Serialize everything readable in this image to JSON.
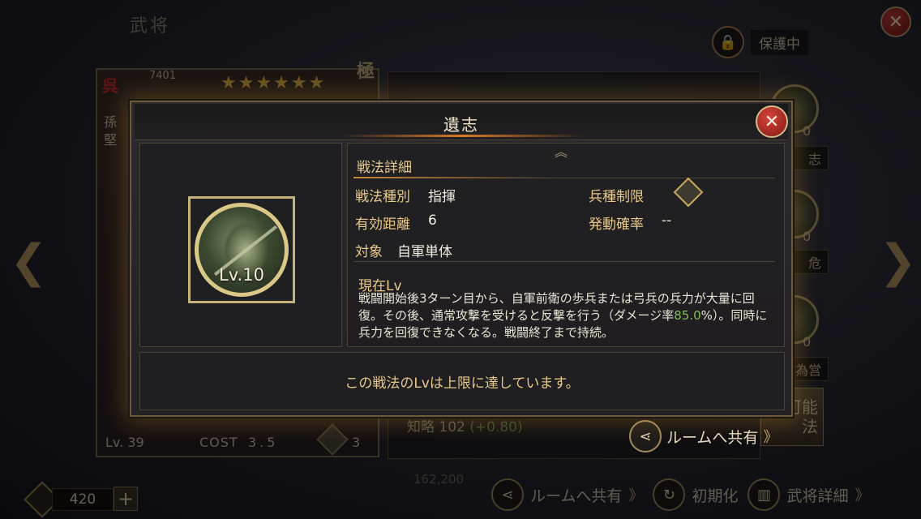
{
  "background": {
    "screen_title": "武将",
    "lock_label": "保護中",
    "card": {
      "kingdom": "呉",
      "number": "7401",
      "stars": "★★★★★★",
      "name": "孫堅",
      "grade": "極",
      "level": "Lv. 39",
      "cost_label": "COST",
      "cost_value": "3.5",
      "troop_number": "3"
    },
    "side_tags": [
      "志",
      "危",
      "為営"
    ],
    "side_nums": [
      "0",
      "0",
      "0"
    ],
    "intel_label": "知略",
    "intel_value": "102",
    "intel_bonus": "(+0.80)",
    "faint_stat": "162,200",
    "possible_button": [
      "可能",
      "法"
    ],
    "share_inner": "ルームへ共有",
    "gem_count": "420",
    "plus": "+",
    "bottom_actions": {
      "share": "ルームへ共有",
      "reset": "初期化",
      "detail": "武将詳細"
    },
    "chevrons": "》"
  },
  "modal": {
    "title": "遺志",
    "skill_level": "Lv.10",
    "section_title": "戦法詳細",
    "rows": {
      "type_label": "戦法種別",
      "type_value": "指揮",
      "troop_label": "兵種制限",
      "range_label": "有効距離",
      "range_value": "6",
      "rate_label": "発動確率",
      "rate_value": "--",
      "target_label": "対象",
      "target_value": "自軍単体"
    },
    "current_lv": "現在Lv",
    "description_part1": "戦闘開始後3ターン目から、自軍前衛の歩兵または弓兵の兵力が大量に回復。その後、通常攻撃を受けると反撃を行う（ダメージ率",
    "description_highlight": "85.0",
    "description_part2": "%）。同時に兵力を回復できなくなる。戦闘終了まで持続。",
    "max_message": "この戦法のLvは上限に達しています。"
  },
  "colors": {
    "accent_gold": "#e7c98b",
    "highlight_green": "#7fbf5b",
    "close_red": "#c8403a"
  }
}
